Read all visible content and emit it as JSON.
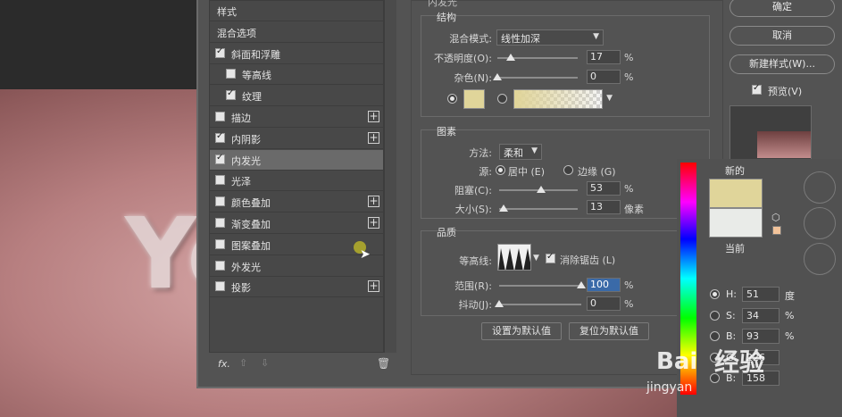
{
  "style_list": {
    "items": [
      {
        "label": "样式",
        "checkbox": false,
        "checked": false,
        "plus": false,
        "selected": false,
        "indent": 0
      },
      {
        "label": "混合选项",
        "checkbox": false,
        "checked": false,
        "plus": false,
        "selected": false,
        "indent": 0
      },
      {
        "label": "斜面和浮雕",
        "checkbox": true,
        "checked": true,
        "plus": false,
        "selected": false,
        "indent": 0
      },
      {
        "label": "等高线",
        "checkbox": true,
        "checked": false,
        "plus": false,
        "selected": false,
        "indent": 1
      },
      {
        "label": "纹理",
        "checkbox": true,
        "checked": true,
        "plus": false,
        "selected": false,
        "indent": 1
      },
      {
        "label": "描边",
        "checkbox": true,
        "checked": false,
        "plus": true,
        "selected": false,
        "indent": 0
      },
      {
        "label": "内阴影",
        "checkbox": true,
        "checked": true,
        "plus": true,
        "selected": false,
        "indent": 0
      },
      {
        "label": "内发光",
        "checkbox": true,
        "checked": true,
        "plus": false,
        "selected": true,
        "indent": 0
      },
      {
        "label": "光泽",
        "checkbox": true,
        "checked": false,
        "plus": false,
        "selected": false,
        "indent": 0
      },
      {
        "label": "颜色叠加",
        "checkbox": true,
        "checked": false,
        "plus": true,
        "selected": false,
        "indent": 0
      },
      {
        "label": "渐变叠加",
        "checkbox": true,
        "checked": false,
        "plus": true,
        "selected": false,
        "indent": 0
      },
      {
        "label": "图案叠加",
        "checkbox": true,
        "checked": false,
        "plus": false,
        "selected": false,
        "indent": 0
      },
      {
        "label": "外发光",
        "checkbox": true,
        "checked": false,
        "plus": false,
        "selected": false,
        "indent": 0
      },
      {
        "label": "投影",
        "checkbox": true,
        "checked": false,
        "plus": true,
        "selected": false,
        "indent": 0
      }
    ],
    "footer": {
      "fx": "fx.",
      "up": "⇧",
      "down": "⇩",
      "trash": "🗑"
    }
  },
  "inner_glow": {
    "panel_title": "内发光",
    "structure": {
      "title": "结构",
      "blend_mode_label": "混合模式:",
      "blend_mode_value": "线性加深",
      "opacity_label": "不透明度(O):",
      "opacity_value": 17,
      "noise_label": "杂色(N):",
      "noise_value": 0,
      "percent": "%",
      "glow_color": "#e0d59a"
    },
    "elements": {
      "title": "图素",
      "method_label": "方法:",
      "method_value": "柔和",
      "source_label": "源:",
      "source_center": "居中 (E)",
      "source_edge": "边缘 (G)",
      "choke_label": "阻塞(C):",
      "choke_value": 53,
      "size_label": "大小(S):",
      "size_value": 13,
      "size_unit": "像素"
    },
    "quality": {
      "title": "品质",
      "contour_label": "等高线:",
      "antialias_label": "消除锯齿 (L)",
      "range_label": "范围(R):",
      "range_value": 100,
      "jitter_label": "抖动(J):",
      "jitter_value": 0
    },
    "buttons": {
      "set_default": "设置为默认值",
      "reset_default": "复位为默认值"
    }
  },
  "right_column": {
    "ok": "确定",
    "cancel": "取消",
    "new_style": "新建样式(W)...",
    "preview_label": "预览(V)"
  },
  "color_picker": {
    "new_label": "新的",
    "current_label": "当前",
    "new_color": "#e0d59a",
    "current_color": "#e9ebe8",
    "mini_color": "#f2c39a",
    "fields": [
      {
        "key": "H:",
        "value": "51",
        "unit": "度",
        "selected": true
      },
      {
        "key": "S:",
        "value": "34",
        "unit": "%",
        "selected": false
      },
      {
        "key": "B:",
        "value": "93",
        "unit": "%",
        "selected": false
      },
      {
        "key": "G:",
        "value": "226",
        "unit": "",
        "selected": false
      },
      {
        "key": "B:",
        "value": "158",
        "unit": "",
        "selected": false
      }
    ]
  },
  "watermark": {
    "text1": "Bai",
    "text2": "经验",
    "text3": "jingyan"
  }
}
